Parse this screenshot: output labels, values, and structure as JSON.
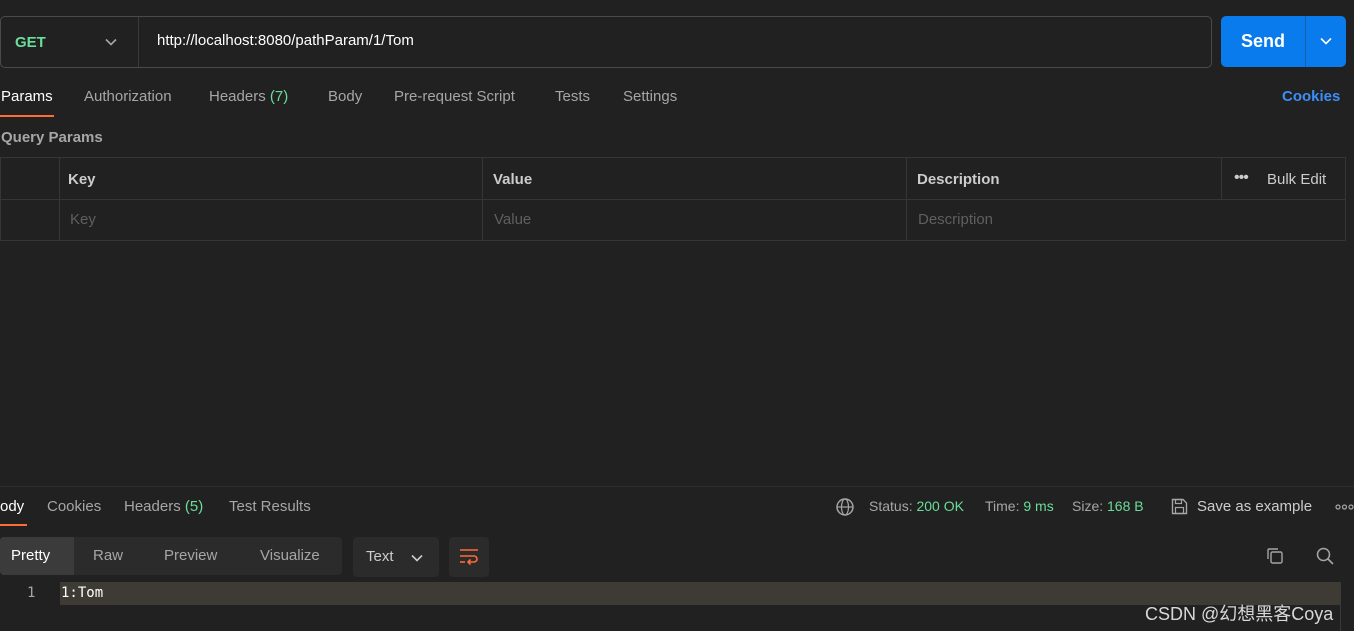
{
  "request": {
    "method": "GET",
    "url": "http://localhost:8080/pathParam/1/Tom",
    "send_label": "Send"
  },
  "request_tabs": [
    {
      "label": "Params",
      "active": true
    },
    {
      "label": "Authorization"
    },
    {
      "label": "Headers",
      "count": "(7)"
    },
    {
      "label": "Body"
    },
    {
      "label": "Pre-request Script"
    },
    {
      "label": "Tests"
    },
    {
      "label": "Settings"
    }
  ],
  "cookies_label": "Cookies",
  "query_params": {
    "title": "Query Params",
    "headers": [
      "Key",
      "Value",
      "Description"
    ],
    "bulk_edit_label": "Bulk Edit",
    "placeholders": [
      "Key",
      "Value",
      "Description"
    ]
  },
  "response_tabs": [
    {
      "label": "ody",
      "active": true
    },
    {
      "label": "Cookies"
    },
    {
      "label": "Headers",
      "count": "(5)"
    },
    {
      "label": "Test Results"
    }
  ],
  "response_meta": {
    "status_label": "Status:",
    "status_value": "200 OK",
    "time_label": "Time:",
    "time_value": "9 ms",
    "size_label": "Size:",
    "size_value": "168 B",
    "save_example_label": "Save as example"
  },
  "format_tabs": [
    "Pretty",
    "Raw",
    "Preview",
    "Visualize"
  ],
  "format_select": "Text",
  "code": [
    {
      "line": "1",
      "text": "1:Tom"
    }
  ],
  "watermark": "CSDN @幻想黑客Coya",
  "colors": {
    "accent_orange": "#ff6c37",
    "send_blue": "#097bed",
    "success_green": "#6bdd9a",
    "link_blue": "#3d8ef7"
  }
}
